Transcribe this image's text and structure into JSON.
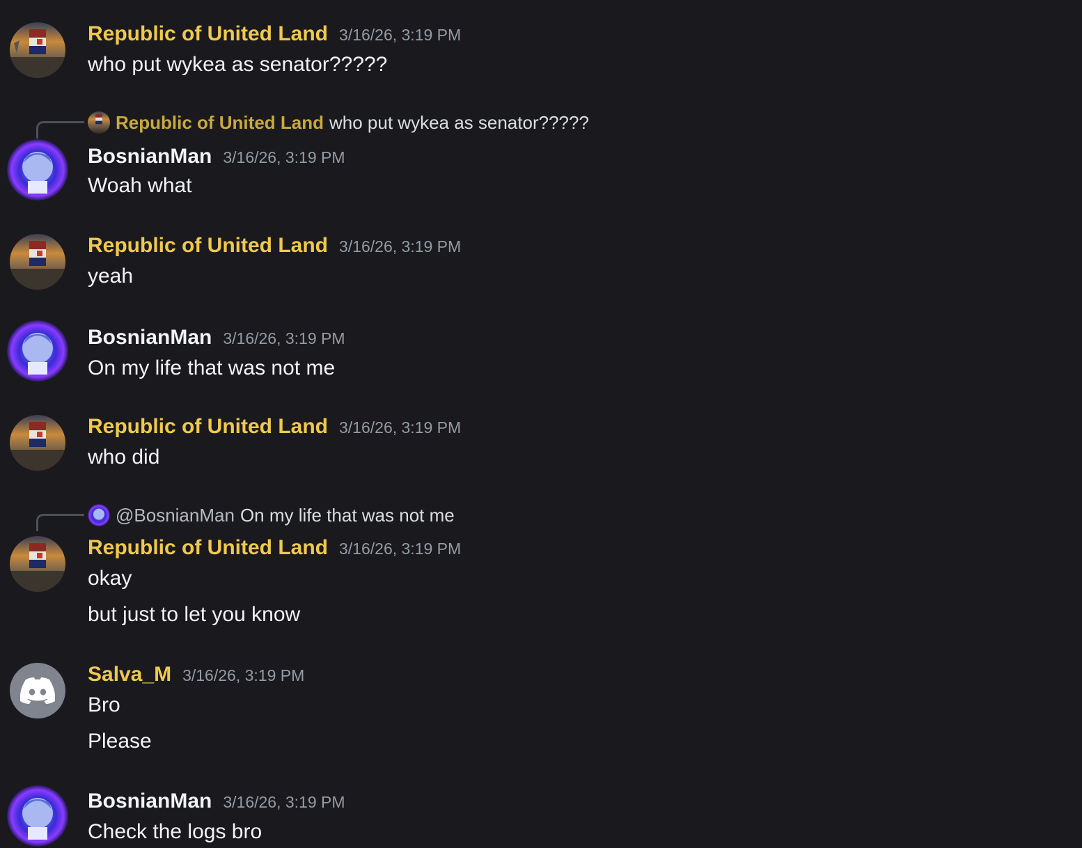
{
  "users": {
    "rul": "Republic of United Land",
    "bosnian": "BosnianMan",
    "salva": "Salva_M"
  },
  "colors": {
    "background": "#1a1a1e",
    "role_gold": "#f0c94c",
    "timestamp": "#949ba4",
    "text": "#f2f3f5"
  },
  "messages": [
    {
      "author": "Republic of United Land",
      "timestamp": "3/16/26, 3:19 PM",
      "lines": [
        "who put wykea as senator?????"
      ]
    },
    {
      "reply_to": {
        "name": "Republic of United Land",
        "text": "who put wykea as senator?????"
      },
      "author": "BosnianMan",
      "timestamp": "3/16/26, 3:19 PM",
      "lines": [
        "Woah what"
      ]
    },
    {
      "author": "Republic of United Land",
      "timestamp": "3/16/26, 3:19 PM",
      "lines": [
        "yeah"
      ]
    },
    {
      "author": "BosnianMan",
      "timestamp": "3/16/26, 3:19 PM",
      "lines": [
        "On my life that was not me"
      ]
    },
    {
      "author": "Republic of United Land",
      "timestamp": "3/16/26, 3:19 PM",
      "lines": [
        "who did"
      ]
    },
    {
      "reply_to": {
        "name": "@BosnianMan",
        "text": "On my life that was not me"
      },
      "author": "Republic of United Land",
      "timestamp": "3/16/26, 3:19 PM",
      "lines": [
        "okay",
        "but just to let you know"
      ]
    },
    {
      "author": "Salva_M",
      "timestamp": "3/16/26, 3:19 PM",
      "lines": [
        "Bro",
        "Please"
      ]
    },
    {
      "author": "BosnianMan",
      "timestamp": "3/16/26, 3:19 PM",
      "lines": [
        "Check the logs bro"
      ]
    }
  ]
}
